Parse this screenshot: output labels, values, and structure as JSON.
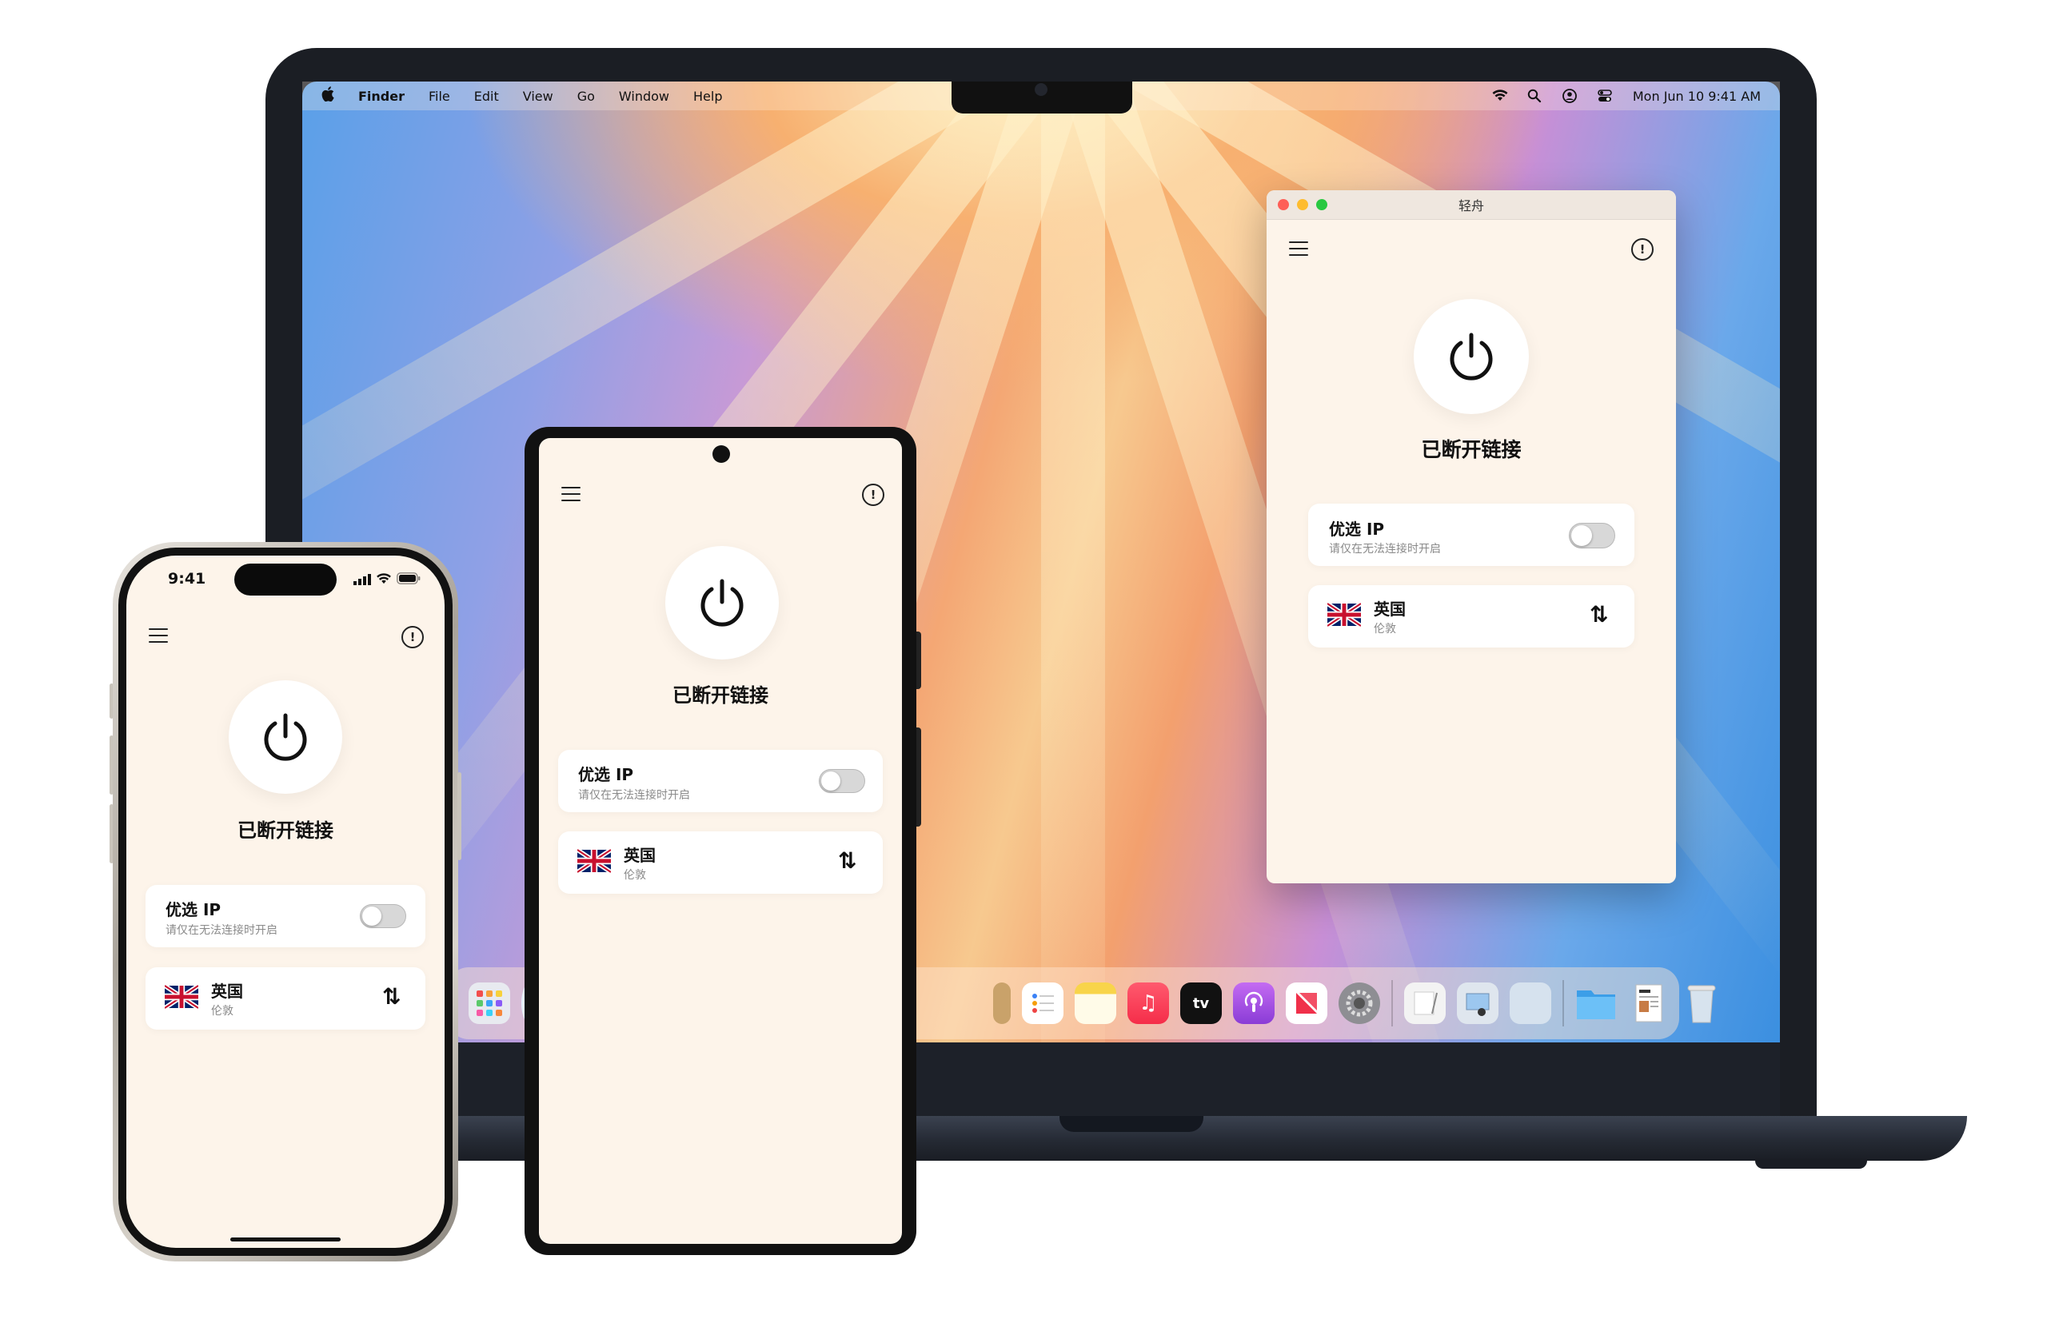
{
  "mac": {
    "menubar": {
      "apple": "",
      "items": [
        "Finder",
        "File",
        "Edit",
        "View",
        "Go",
        "Window",
        "Help"
      ],
      "clock": "Mon Jun 10  9:41 AM"
    },
    "window": {
      "title": "轻舟"
    },
    "dock": {
      "icons": [
        "launchpad",
        "safari",
        "photos",
        "reminders",
        "notes",
        "music",
        "apple-tv",
        "podcasts",
        "news",
        "system-settings",
        "textedit",
        "preview",
        "blank-app",
        "folder",
        "document",
        "trash"
      ]
    }
  },
  "iphone": {
    "time": "9:41"
  },
  "app": {
    "status": "已断开链接",
    "preferred_ip": {
      "title": "优选 IP",
      "subtitle": "请仅在无法连接时开启",
      "enabled": false
    },
    "location": {
      "country": "英国",
      "city": "伦敦",
      "flag": "uk-flag"
    },
    "swap_icon": "⇅",
    "info_icon": "!"
  },
  "colors": {
    "app_background": "#fdf4ea",
    "card_background": "#ffffff",
    "text_primary": "#111111",
    "text_secondary": "#8a8a8a"
  }
}
